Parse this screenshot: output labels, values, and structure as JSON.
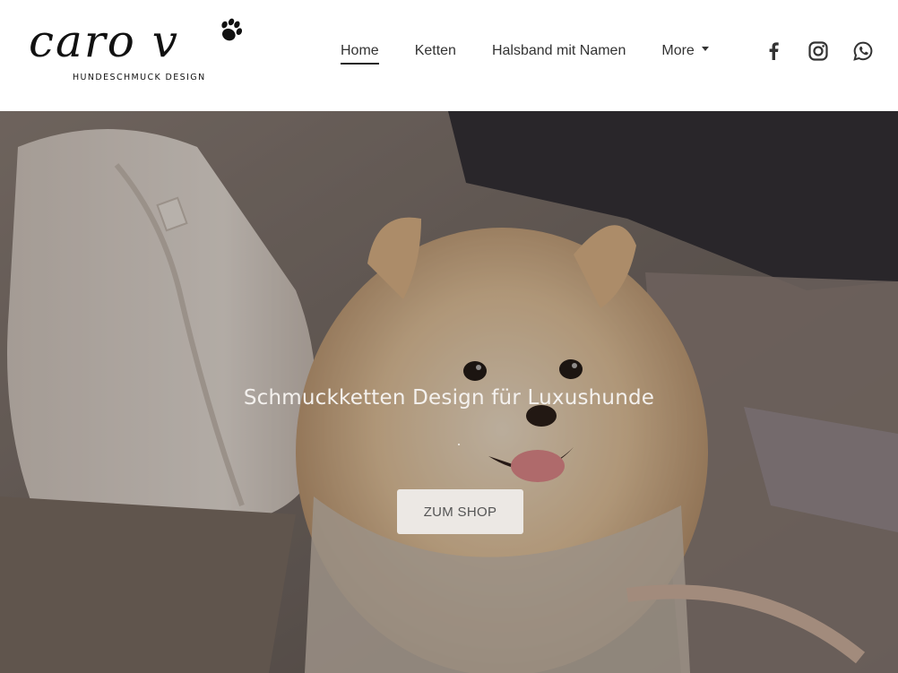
{
  "brand": {
    "script_name": "caro v",
    "tagline": "HUNDESCHMUCK DESIGN",
    "logo_icon": "paw-icon"
  },
  "nav": {
    "items": [
      {
        "label": "Home",
        "active": true
      },
      {
        "label": "Ketten",
        "active": false
      },
      {
        "label": "Halsband mit Namen",
        "active": false
      },
      {
        "label": "More",
        "active": false,
        "dropdown": true
      }
    ]
  },
  "social": {
    "items": [
      {
        "icon": "facebook-icon"
      },
      {
        "icon": "instagram-icon"
      },
      {
        "icon": "whatsapp-icon"
      }
    ]
  },
  "hero": {
    "title": "Schmuckketten Design für Luxushunde",
    "subtitle": ".",
    "button_label": "ZUM SHOP"
  },
  "colors": {
    "text_dark": "#333333",
    "hero_text": "#f4f1ee",
    "button_bg": "#ece8e4",
    "button_text": "#555555"
  }
}
